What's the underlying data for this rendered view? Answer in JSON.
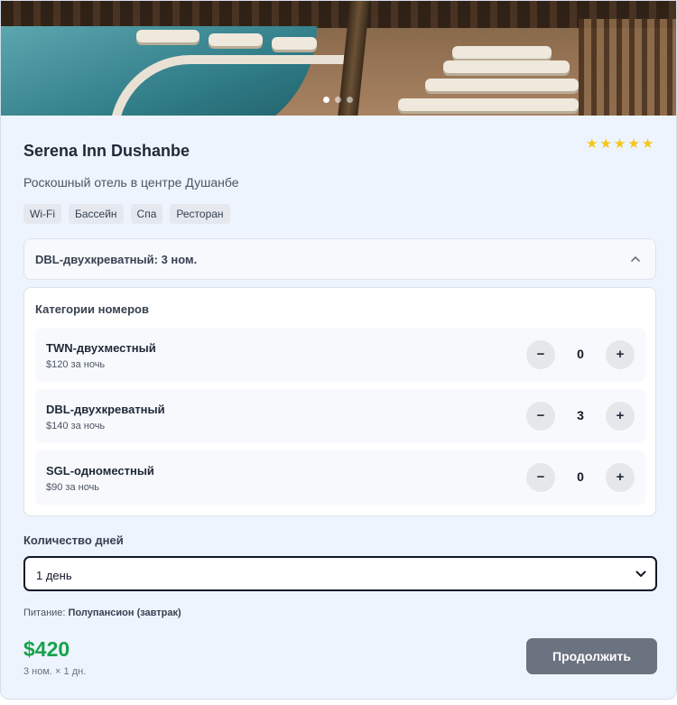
{
  "hero": {
    "dots": 3,
    "active_dot": 0
  },
  "hotel": {
    "name": "Serena Inn Dushanbe",
    "stars": 5,
    "description": "Роскошный отель в центре Душанбе",
    "tags": [
      "Wi-Fi",
      "Бассейн",
      "Спа",
      "Ресторан"
    ]
  },
  "summary": {
    "label": "DBL-двухкреватный: 3 ном.",
    "icon": "chevron-up-icon"
  },
  "categories": {
    "title": "Категории номеров",
    "rooms": [
      {
        "name": "TWN-двухместный",
        "price": "$120 за ночь",
        "count": "0"
      },
      {
        "name": "DBL-двухкреватный",
        "price": "$140 за ночь",
        "count": "3"
      },
      {
        "name": "SGL-одноместный",
        "price": "$90 за ночь",
        "count": "0"
      }
    ],
    "minus": "−",
    "plus": "+"
  },
  "days": {
    "label": "Количество дней",
    "selected": "1 день"
  },
  "meal": {
    "prefix": "Питание: ",
    "value": "Полупансион (завтрак)"
  },
  "footer": {
    "total": "$420",
    "breakdown": "3 ном. × 1 дн.",
    "continue_label": "Продолжить"
  },
  "colors": {
    "accent_green": "#16a34a",
    "star": "#f5c518",
    "button_gray": "#6b7280",
    "card_bg": "#eef4fd"
  }
}
